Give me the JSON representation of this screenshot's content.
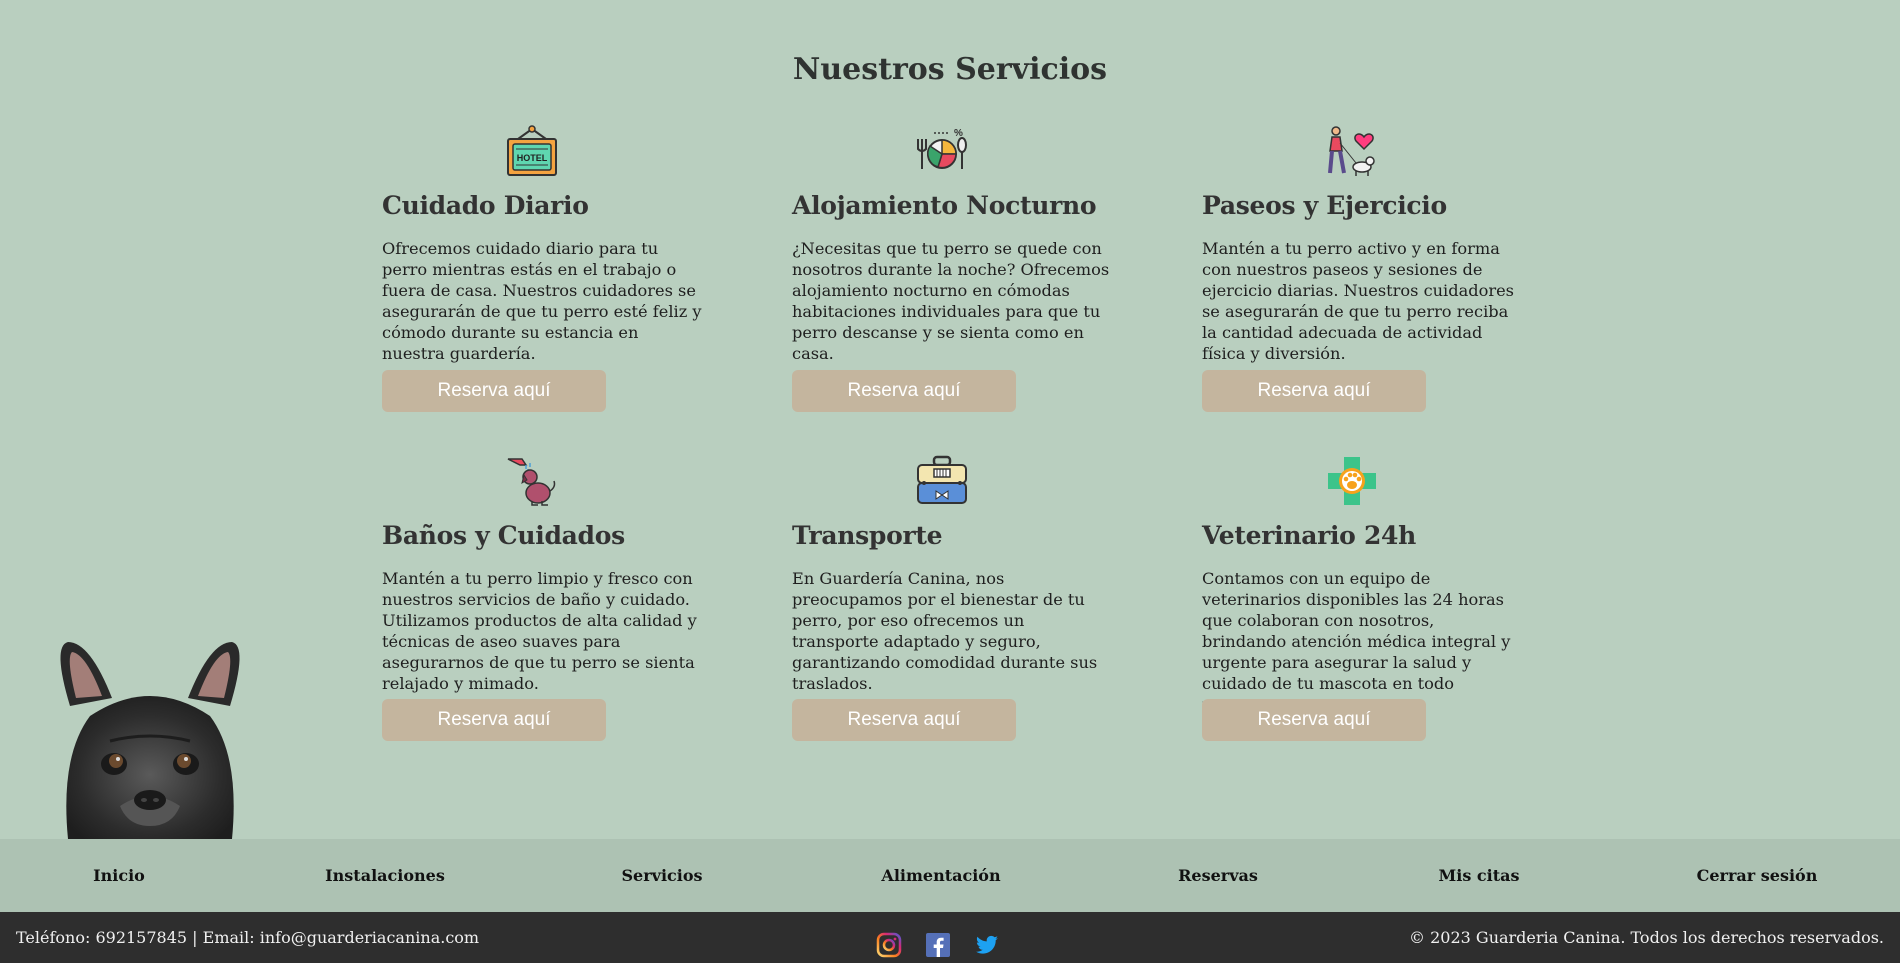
{
  "page": {
    "title": "Nuestros Servicios"
  },
  "services": [
    {
      "icon": "hotel-sign-icon",
      "title": "Cuidado Diario",
      "description": "Ofrecemos cuidado diario para tu perro mientras estás en el trabajo o fuera de casa. Nuestros cuidadores se asegurarán de que tu perro esté feliz y cómodo durante su estancia en nuestra guardería.",
      "button": "Reserva aquí",
      "icon_text": "HOTEL"
    },
    {
      "icon": "food-bowl-icon",
      "title": "Alojamiento Nocturno",
      "description": "¿Necesitas que tu perro se quede con nosotros durante la noche? Ofrecemos alojamiento nocturno en cómodas habitaciones individuales para que tu perro descanse y se sienta como en casa.",
      "button": "Reserva aquí"
    },
    {
      "icon": "dog-walk-icon",
      "title": "Paseos y Ejercicio",
      "description": "Mantén a tu perro activo y en forma con nuestros paseos y sesiones de ejercicio diarias. Nuestros cuidadores se asegurarán de que tu perro reciba la cantidad adecuada de actividad física y diversión.",
      "button": "Reserva aquí"
    },
    {
      "icon": "dog-bath-icon",
      "title": "Baños y Cuidados",
      "description": "Mantén a tu perro limpio y fresco con nuestros servicios de baño y cuidado. Utilizamos productos de alta calidad y técnicas de aseo suaves para asegurarnos de que tu perro se sienta relajado y mimado.",
      "button": "Reserva aquí"
    },
    {
      "icon": "pet-carrier-icon",
      "title": "Transporte",
      "description": "En Guardería Canina, nos preocupamos por el bienestar de tu perro, por eso ofrecemos un transporte adaptado y seguro, garantizando comodidad durante sus traslados.",
      "button": "Reserva aquí"
    },
    {
      "icon": "vet-cross-paw-icon",
      "title": "Veterinario 24h",
      "description": "Contamos con un equipo de veterinarios disponibles las 24 horas que colaboran con nosotros, brindando atención médica integral y urgente para asegurar la salud y cuidado de tu mascota en todo momento.",
      "button": "Reserva aquí"
    }
  ],
  "nav": {
    "items": [
      "Inicio",
      "Instalaciones",
      "Servicios",
      "Alimentación",
      "Reservas",
      "Mis citas",
      "Cerrar sesión"
    ]
  },
  "footer": {
    "contact": "Teléfono: 692157845 | Email: info@guarderiacanina.com",
    "copyright": "© 2023 Guarderia Canina. Todos los derechos reservados.",
    "social": [
      "instagram-icon",
      "facebook-icon",
      "twitter-icon"
    ]
  },
  "colors": {
    "background": "#b9cfbf",
    "button": "#c4b59e",
    "nav": "#adc2b3",
    "footer": "#2e2e2e"
  }
}
